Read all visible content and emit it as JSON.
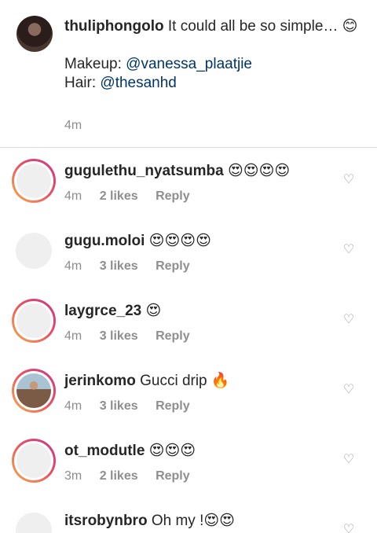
{
  "caption": {
    "username": "thuliphongolo",
    "text": "It could all be so simple… 😊",
    "makeup_label": "Makeup:",
    "makeup_mention": "@vanessa_plaatjie",
    "hair_label": "Hair:",
    "hair_mention": "@thesanhd",
    "time": "4m"
  },
  "comments": [
    {
      "username": "gugulethu_nyatsumba",
      "text": "😍😍😍😍",
      "time": "4m",
      "likes": "2 likes",
      "reply": "Reply"
    },
    {
      "username": "gugu.moloi",
      "text": "😍😍😍😍",
      "time": "4m",
      "likes": "3 likes",
      "reply": "Reply"
    },
    {
      "username": "laygrce_23",
      "text": "😍",
      "time": "4m",
      "likes": "3 likes",
      "reply": "Reply"
    },
    {
      "username": "jerinkomo",
      "text": "Gucci drip 🔥",
      "time": "4m",
      "likes": "3 likes",
      "reply": "Reply"
    },
    {
      "username": "ot_modutle",
      "text": "😍😍😍",
      "time": "3m",
      "likes": "2 likes",
      "reply": "Reply"
    },
    {
      "username": "itsrobynbro",
      "text": "Oh my !😍😍",
      "time": "",
      "likes": "",
      "reply": ""
    }
  ],
  "icons": {
    "like": "heart-outline-icon"
  }
}
